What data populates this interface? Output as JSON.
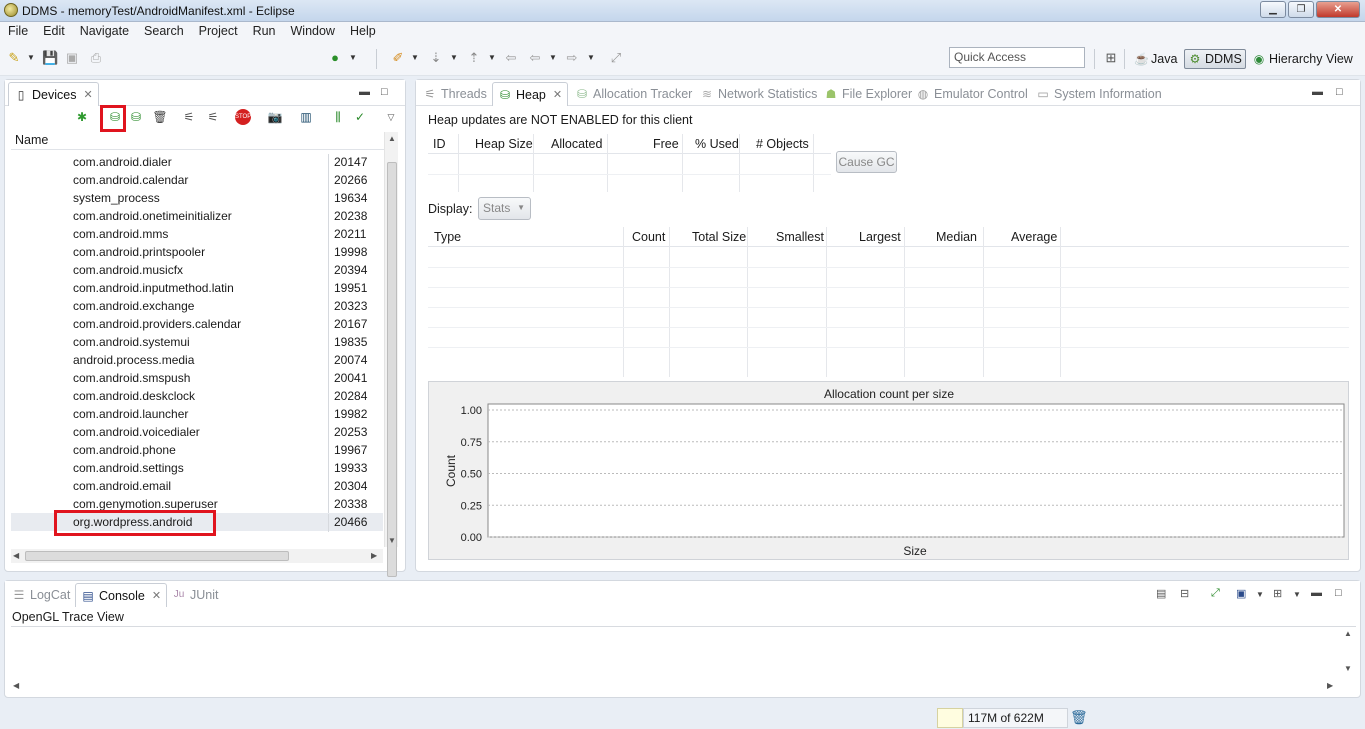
{
  "window": {
    "title": "DDMS - memoryTest/AndroidManifest.xml - Eclipse",
    "min": "▁",
    "max": "❐",
    "close": "✕"
  },
  "menu": [
    "File",
    "Edit",
    "Navigate",
    "Search",
    "Project",
    "Run",
    "Window",
    "Help"
  ],
  "toolbar": {
    "quick_access_placeholder": "Quick Access",
    "perspectives": {
      "java": "Java",
      "ddms": "DDMS",
      "hierarchy": "Hierarchy View"
    }
  },
  "devices": {
    "tab_label": "Devices",
    "column_name": "Name",
    "rows": [
      {
        "name": "com.android.dialer",
        "pid": "20147"
      },
      {
        "name": "com.android.calendar",
        "pid": "20266"
      },
      {
        "name": "system_process",
        "pid": "19634"
      },
      {
        "name": "com.android.onetimeinitializer",
        "pid": "20238"
      },
      {
        "name": "com.android.mms",
        "pid": "20211"
      },
      {
        "name": "com.android.printspooler",
        "pid": "19998"
      },
      {
        "name": "com.android.musicfx",
        "pid": "20394"
      },
      {
        "name": "com.android.inputmethod.latin",
        "pid": "19951"
      },
      {
        "name": "com.android.exchange",
        "pid": "20323"
      },
      {
        "name": "com.android.providers.calendar",
        "pid": "20167"
      },
      {
        "name": "com.android.systemui",
        "pid": "19835"
      },
      {
        "name": "android.process.media",
        "pid": "20074"
      },
      {
        "name": "com.android.smspush",
        "pid": "20041"
      },
      {
        "name": "com.android.deskclock",
        "pid": "20284"
      },
      {
        "name": "com.android.launcher",
        "pid": "19982"
      },
      {
        "name": "com.android.voicedialer",
        "pid": "20253"
      },
      {
        "name": "com.android.phone",
        "pid": "19967"
      },
      {
        "name": "com.android.settings",
        "pid": "19933"
      },
      {
        "name": "com.android.email",
        "pid": "20304"
      },
      {
        "name": "com.genymotion.superuser",
        "pid": "20338"
      },
      {
        "name": "org.wordpress.android",
        "pid": "20466"
      }
    ],
    "selected_row": "org.wordpress.android"
  },
  "right_tabs": {
    "threads": "Threads",
    "heap": "Heap",
    "allocation": "Allocation Tracker",
    "network": "Network Statistics",
    "files": "File Explorer",
    "emulator": "Emulator Control",
    "sysinfo": "System Information"
  },
  "heap": {
    "notice": "Heap updates are NOT ENABLED for this client",
    "columns": [
      "ID",
      "Heap Size",
      "Allocated",
      "Free",
      "% Used",
      "# Objects"
    ],
    "cause_gc": "Cause GC",
    "display_label": "Display:",
    "display_value": "Stats",
    "stats_columns": [
      "Type",
      "Count",
      "Total Size",
      "Smallest",
      "Largest",
      "Median",
      "Average"
    ]
  },
  "chart_data": {
    "type": "bar",
    "title": "Allocation count per size",
    "xlabel": "Size",
    "ylabel": "Count",
    "ylim": [
      0,
      1
    ],
    "yticks": [
      "1.00",
      "0.75",
      "0.50",
      "0.25",
      "0.00"
    ],
    "categories": [],
    "values": [],
    "grid": true
  },
  "bottom_tabs": {
    "logcat": "LogCat",
    "console": "Console",
    "junit": "JUnit"
  },
  "console": {
    "title": "OpenGL Trace View"
  },
  "status": {
    "memory": "117M of 622M"
  }
}
